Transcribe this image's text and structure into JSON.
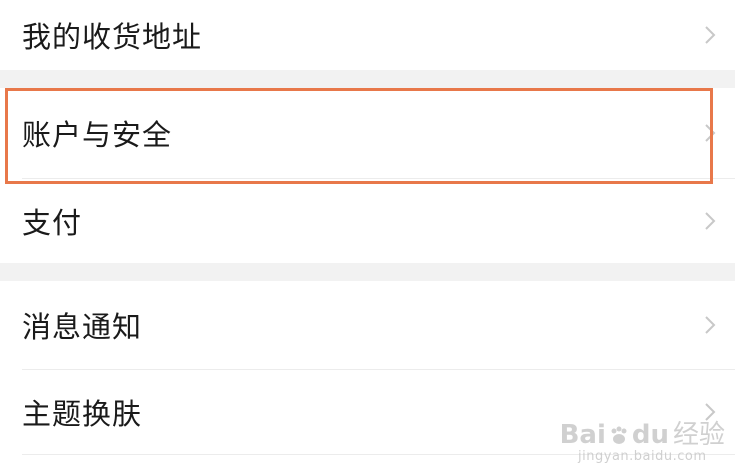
{
  "settings": {
    "items": [
      {
        "label": "我的收货地址",
        "chevron_icon": "chevron-right-icon"
      },
      {
        "label": "账户与安全",
        "chevron_icon": "chevron-right-icon"
      },
      {
        "label": "支付",
        "chevron_icon": "chevron-right-icon"
      },
      {
        "label": "消息通知",
        "chevron_icon": "chevron-right-icon"
      },
      {
        "label": "主题换肤",
        "chevron_icon": "chevron-right-icon"
      }
    ]
  },
  "highlight": {
    "target": "账户与安全",
    "color": "#e8784a"
  },
  "watermark": {
    "brand_left": "Bai",
    "brand_right": "du",
    "brand_cn": "经验",
    "url": "jingyan.baidu.com"
  },
  "colors": {
    "background": "#ffffff",
    "section_gap": "#f2f2f2",
    "text": "#1a1a1a",
    "chevron": "#c8c8c8"
  }
}
